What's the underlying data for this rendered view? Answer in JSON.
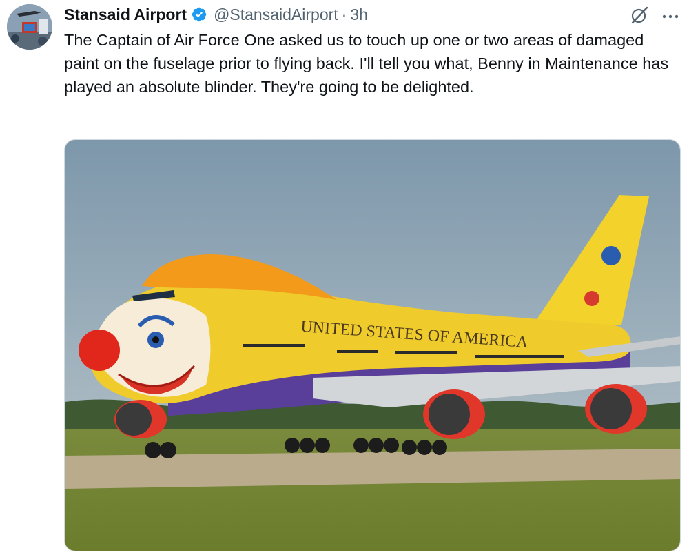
{
  "tweet": {
    "author": {
      "display_name": "Stansaid Airport",
      "handle": "@StansaidAirport",
      "verified": true,
      "avatar_icon": "airport-tower-avatar-icon"
    },
    "separator": "·",
    "timestamp": "3h",
    "text": "The Captain of Air Force One asked us to touch up one or two areas of damaged paint on the fuselage prior to flying back. I'll tell you what, Benny in Maintenance has played an absolute blinder. They're going to be delighted.",
    "image": {
      "fuselage_text": "UNITED STATES OF AMERICA"
    }
  },
  "icons": {
    "verified": "verified-badge-icon",
    "grok": "grok-icon",
    "more": "more-options-icon"
  },
  "colors": {
    "verified_blue": "#1d9bf0",
    "secondary_text": "#536471",
    "primary_text": "#0f1419"
  }
}
